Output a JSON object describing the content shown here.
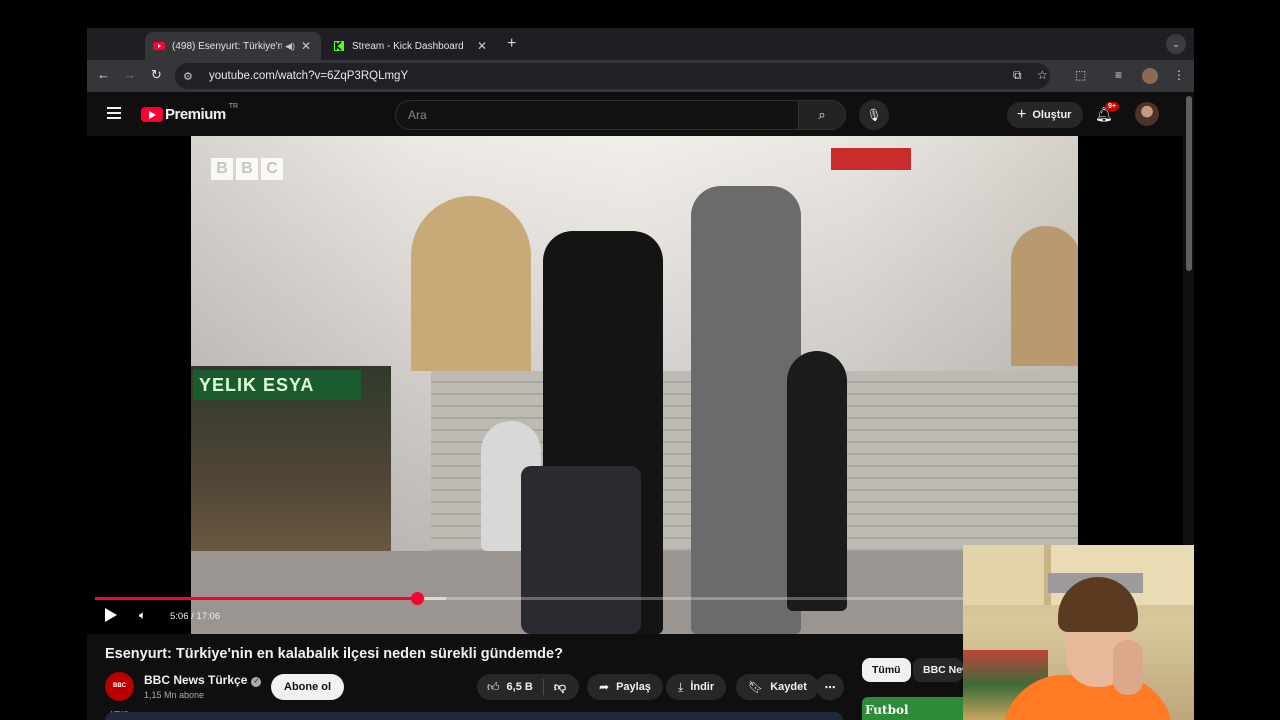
{
  "browser": {
    "tabs": [
      {
        "title": "(498) Esenyurt: Türkiye'n",
        "active": true,
        "audio": true,
        "favicon": "youtube-icon"
      },
      {
        "title": "Stream - Kick Dashboard",
        "active": false,
        "audio": false,
        "favicon": "kick-icon"
      }
    ],
    "new_tab_label": "+",
    "url": "youtube.com/watch?v=6ZqP3RQLmgY"
  },
  "youtube": {
    "logo_text": "Premium",
    "country_code": "TR",
    "search_placeholder": "Ara",
    "create_label": "Oluştur",
    "notification_badge": "9+"
  },
  "player": {
    "watermark": [
      "B",
      "B",
      "C"
    ],
    "shop_sign_text": "YELIK ESYA",
    "time_current": "5:06",
    "time_total": "17:06",
    "time_display": "5:06 / 17:06",
    "progress_fraction": 0.298,
    "buffer_fraction": 0.325
  },
  "video": {
    "title": "Esenyurt: Türkiye'nin en kalabalık ilçesi neden sürekli gündemde?",
    "channel_name": "BBC News Türkçe",
    "channel_avatar_text": "BBC NEWS",
    "subscribers": "1,15 Mn abone",
    "subscribe_label": "Abone ol",
    "likes": "6,5 B",
    "share_label": "Paylaş",
    "download_label": "İndir",
    "save_label": "Kaydet",
    "more_label": "⋯"
  },
  "sidebar": {
    "chips": [
      "Tümü",
      "BBC News"
    ],
    "thumb_text": "Futbol"
  },
  "colors": {
    "youtube_red": "#ff0033",
    "background": "#0f0f0f",
    "kick_green": "#53fc18"
  }
}
